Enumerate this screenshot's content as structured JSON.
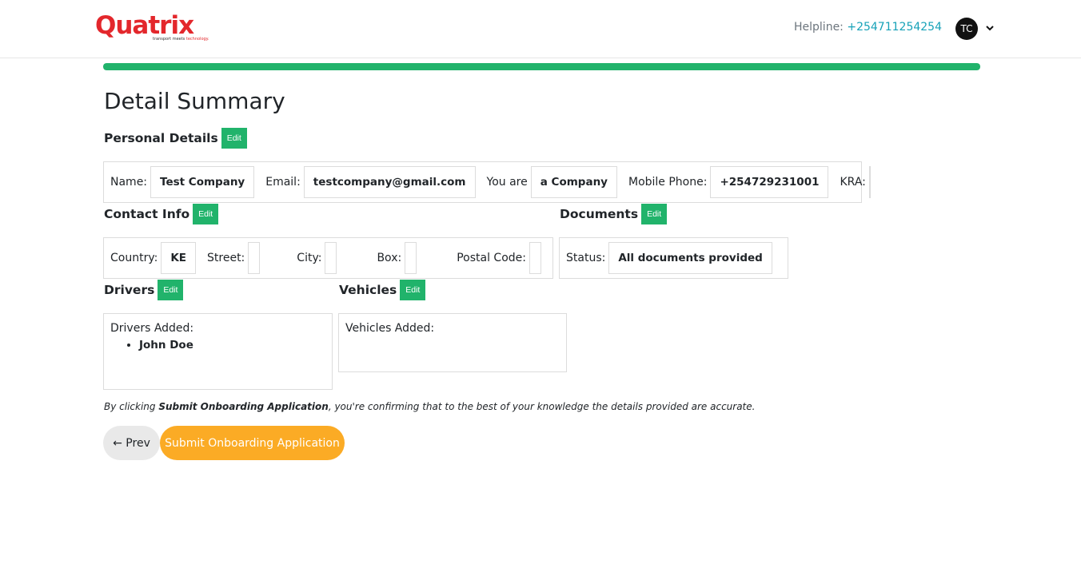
{
  "header": {
    "logo_text": "Quatrix",
    "logo_tagline_a": "transport meets",
    "logo_tagline_b": "technology.",
    "helpline_label": "Helpline:",
    "helpline_number": "+254711254254",
    "avatar_initials": "TC"
  },
  "progress": {
    "percent": 100,
    "color": "#21b36b"
  },
  "page_title": "Detail Summary",
  "edit_label": "Edit",
  "personal": {
    "title": "Personal Details",
    "name_label": "Name:",
    "name_value": "Test Company",
    "email_label": "Email:",
    "email_value": "testcompany@gmail.com",
    "you_are_label": "You are",
    "you_are_value": "a Company",
    "mobile_label": "Mobile Phone:",
    "mobile_value": "+254729231001",
    "kra_label": "KRA:",
    "kra_value": ""
  },
  "contact": {
    "title": "Contact Info",
    "country_label": "Country:",
    "country_value": "KE",
    "street_label": "Street:",
    "street_value": "",
    "city_label": "City:",
    "city_value": "",
    "box_label": "Box:",
    "box_value": "",
    "postal_label": "Postal Code:",
    "postal_value": ""
  },
  "documents": {
    "title": "Documents",
    "status_label": "Status:",
    "status_value": "All documents provided"
  },
  "drivers": {
    "title": "Drivers",
    "added_label": "Drivers Added:",
    "items": [
      "John Doe"
    ]
  },
  "vehicles": {
    "title": "Vehicles",
    "added_label": "Vehicles Added:",
    "items": []
  },
  "notice": {
    "prefix": "By clicking ",
    "bold": "Submit Onboarding Application",
    "suffix": ", you're confirming that to the best of your knowledge the details provided are accurate."
  },
  "buttons": {
    "prev": "← Prev",
    "submit": "Submit Onboarding Application"
  },
  "colors": {
    "accent_green": "#21b36b",
    "accent_orange": "#fbab25",
    "brand_red": "#e3272c",
    "link": "#17a2b8"
  },
  "icons": {
    "account_menu": "chevron-down-icon"
  }
}
